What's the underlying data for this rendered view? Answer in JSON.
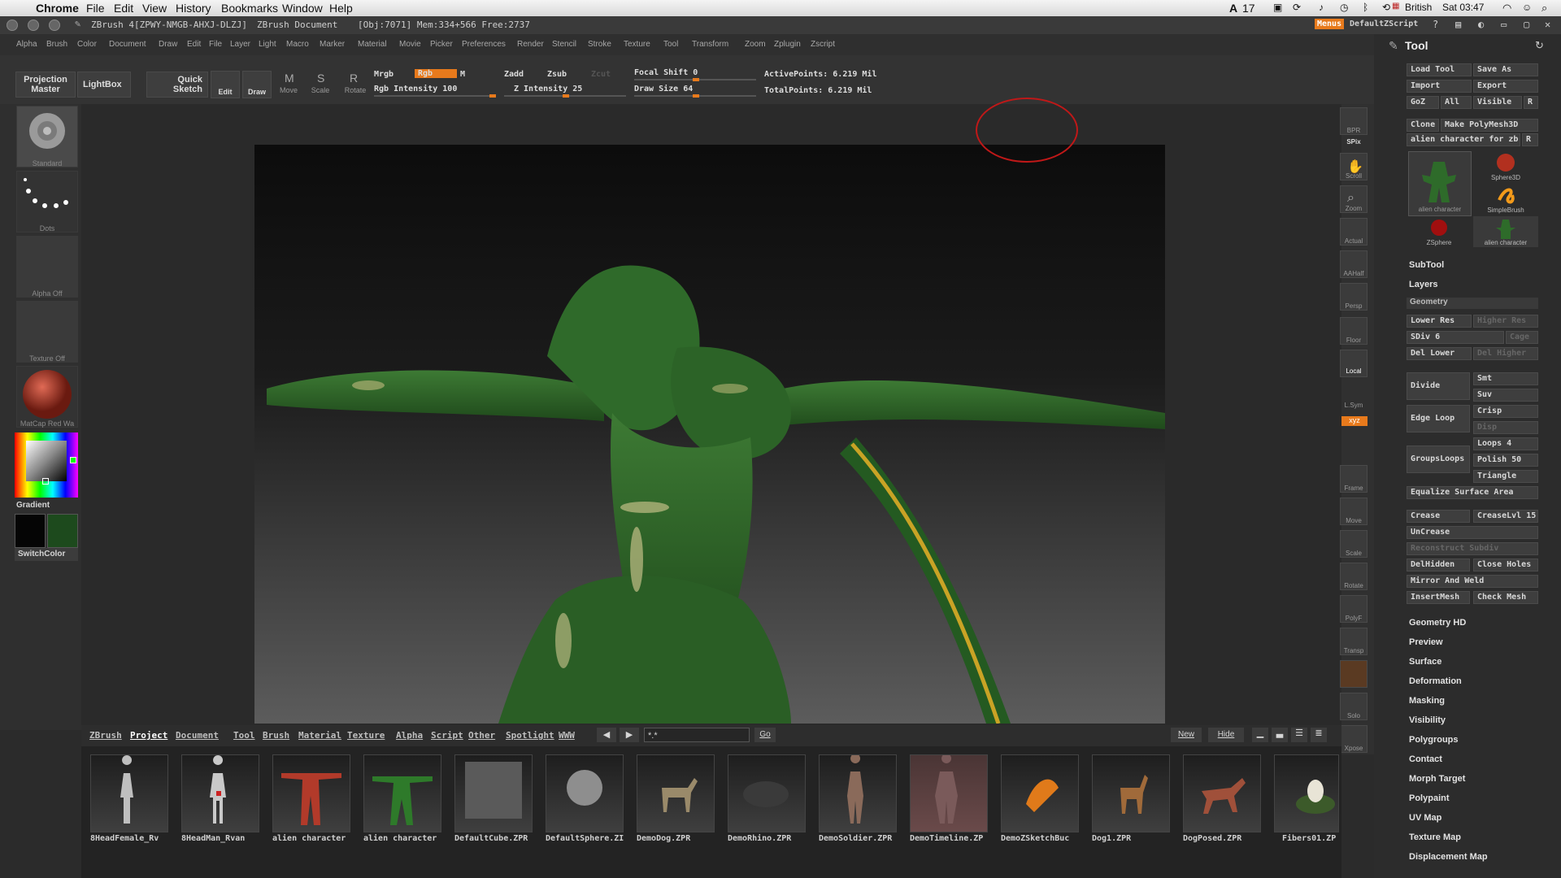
{
  "mac_menubar": {
    "app": "Chrome",
    "items": [
      "File",
      "Edit",
      "View",
      "History",
      "Bookmarks",
      "Window",
      "Help"
    ],
    "status": {
      "adobe_count": "17",
      "keyboard": "British",
      "clock": "Sat 03:47"
    }
  },
  "titlebar": {
    "title": "ZBrush 4[ZPWY-NMGB-AHXJ-DLZJ]",
    "doc": "ZBrush Document",
    "info": "[Obj:7071] Mem:334+566 Free:2737",
    "menus_button": "Menus",
    "script": "DefaultZScript"
  },
  "menubar": [
    "Alpha",
    "Brush",
    "Color",
    "Document",
    "Draw",
    "Edit",
    "File",
    "Layer",
    "Light",
    "Macro",
    "Marker",
    "Material",
    "Movie",
    "Picker",
    "Preferences",
    "Render",
    "Stencil",
    "Stroke",
    "Texture",
    "Tool",
    "Transform",
    "Zoom",
    "Zplugin",
    "Zscript"
  ],
  "shelf": {
    "projection_master": "Projection Master",
    "lightbox": "LightBox",
    "quick_sketch": "Quick Sketch",
    "edit": "Edit",
    "draw": "Draw",
    "move": "Move",
    "scale": "Scale",
    "rotate": "Rotate",
    "mrgb": "Mrgb",
    "rgb": "Rgb",
    "m": "M",
    "zadd": "Zadd",
    "zsub": "Zsub",
    "zcut": "Zcut",
    "rgb_intensity": "Rgb Intensity 100",
    "z_intensity": "Z Intensity 25",
    "focal_shift": "Focal Shift 0",
    "draw_size": "Draw Size 64",
    "active_points": "ActivePoints: 6.219 Mil",
    "total_points": "TotalPoints: 6.219 Mil"
  },
  "left_shelf": {
    "brush": "Standard",
    "stroke": "Dots",
    "alpha": "Alpha Off",
    "texture": "Texture Off",
    "material": "MatCap Red Wa",
    "gradient": "Gradient",
    "switchcolor": "SwitchColor"
  },
  "right_shelf": [
    "BPR",
    "SPix",
    "Scroll",
    "Zoom",
    "Actual",
    "AAHalf",
    "Persp",
    "Floor",
    "Local",
    "L.Sym",
    "Frame",
    "Move",
    "Scale",
    "Rotate",
    "PolyF",
    "Transp",
    "Solo",
    "Xpose"
  ],
  "tool_palette": {
    "title": "Tool",
    "load_tool": "Load Tool",
    "save_as": "Save As",
    "import": "Import",
    "export": "Export",
    "goz": "GoZ",
    "all": "All",
    "visible": "Visible",
    "r": "R",
    "clone": "Clone",
    "make_polymesh": "Make PolyMesh3D",
    "current_tool": "alien character for zb",
    "thumbs": [
      "alien character",
      "Sphere3D",
      "SimpleBrush",
      "ZSphere",
      "alien character"
    ],
    "sections_top": [
      "SubTool",
      "Layers"
    ],
    "geometry": {
      "header": "Geometry",
      "lower_res": "Lower Res",
      "higher_res": "Higher Res",
      "sdiv": "SDiv 6",
      "cage": "Cage",
      "del_lower": "Del Lower",
      "del_higher": "Del Higher",
      "divide": "Divide",
      "smt": "Smt",
      "suv": "Suv",
      "edge_loop": "Edge Loop",
      "crisp": "Crisp",
      "disp": "Disp",
      "loops": "Loops 4",
      "groupsloops": "GroupsLoops",
      "polish": "Polish 50",
      "triangle": "Triangle",
      "equalize": "Equalize Surface Area",
      "crease": "Crease",
      "creaselvl": "CreaseLvl 15",
      "uncrease": "UnCrease",
      "reconstruct": "Reconstruct Subdiv",
      "delhidden": "DelHidden",
      "close_holes": "Close Holes",
      "mirror_weld": "Mirror And Weld",
      "insertmesh": "InsertMesh",
      "check_mesh": "Check Mesh"
    },
    "sections_bottom": [
      "Geometry HD",
      "Preview",
      "Surface",
      "Deformation",
      "Masking",
      "Visibility",
      "Polygroups",
      "Contact",
      "Morph Target",
      "Polypaint",
      "UV Map",
      "Texture Map",
      "Displacement Map"
    ]
  },
  "lightbox": {
    "tabs": [
      "ZBrush",
      "Project",
      "Document",
      "Tool",
      "Brush",
      "Material",
      "Texture",
      "Alpha",
      "Script",
      "Other",
      "Spotlight",
      "WWW"
    ],
    "active_tab": "Project",
    "search_value": "*.*",
    "go": "Go",
    "new": "New",
    "hide": "Hide",
    "items": [
      "8HeadFemale_Rv",
      "8HeadMan_Rvan",
      "alien character",
      "alien character",
      "DefaultCube.ZPR",
      "DefaultSphere.ZI",
      "DemoDog.ZPR",
      "DemoRhino.ZPR",
      "DemoSoldier.ZPR",
      "DemoTimeline.ZP",
      "DemoZSketchBuc",
      "Dog1.ZPR",
      "DogPosed.ZPR",
      "Fibers01.ZP"
    ]
  },
  "colors": {
    "accent": "#e87a1c",
    "model_green": "#2e6b2a",
    "bg": "#2b2b2b"
  }
}
